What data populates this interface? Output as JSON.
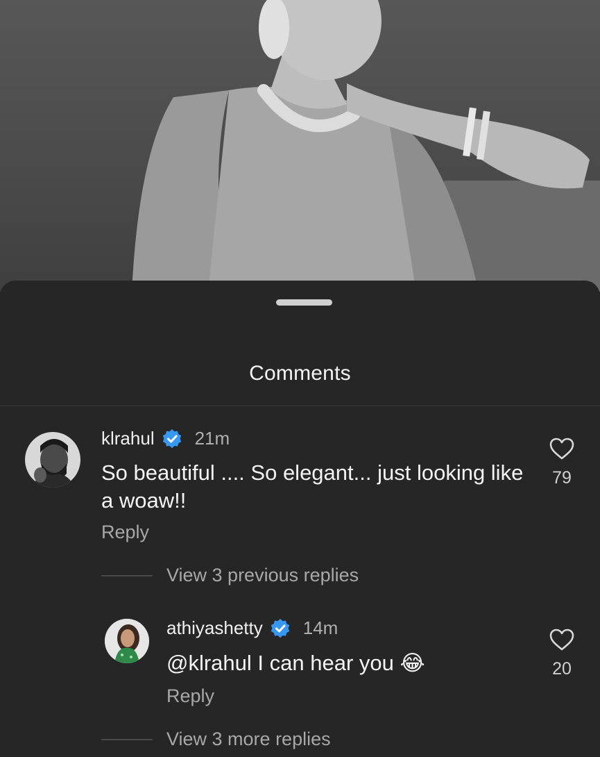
{
  "sheet": {
    "title": "Comments"
  },
  "comments": [
    {
      "username": "klrahul",
      "verified": true,
      "time": "21m",
      "text_line1": "So beautiful .... So elegant... just looking like",
      "text_line2": "a woaw!!",
      "reply_label": "Reply",
      "likes": "79",
      "view_replies_label": "View 3 previous replies"
    }
  ],
  "replies": [
    {
      "username": "athiyashetty",
      "verified": true,
      "time": "14m",
      "mention": "@klrahul",
      "text": " I can hear you ",
      "emoji": "😂",
      "reply_label": "Reply",
      "likes": "20",
      "view_more_label": "View 3 more replies"
    }
  ],
  "icons": {
    "verified": "verified-badge-icon",
    "like": "heart-outline-icon",
    "handle": "drag-handle-icon"
  },
  "colors": {
    "background": "#262626",
    "verified": "#3897f0",
    "muted_text": "#a8a8a8"
  }
}
